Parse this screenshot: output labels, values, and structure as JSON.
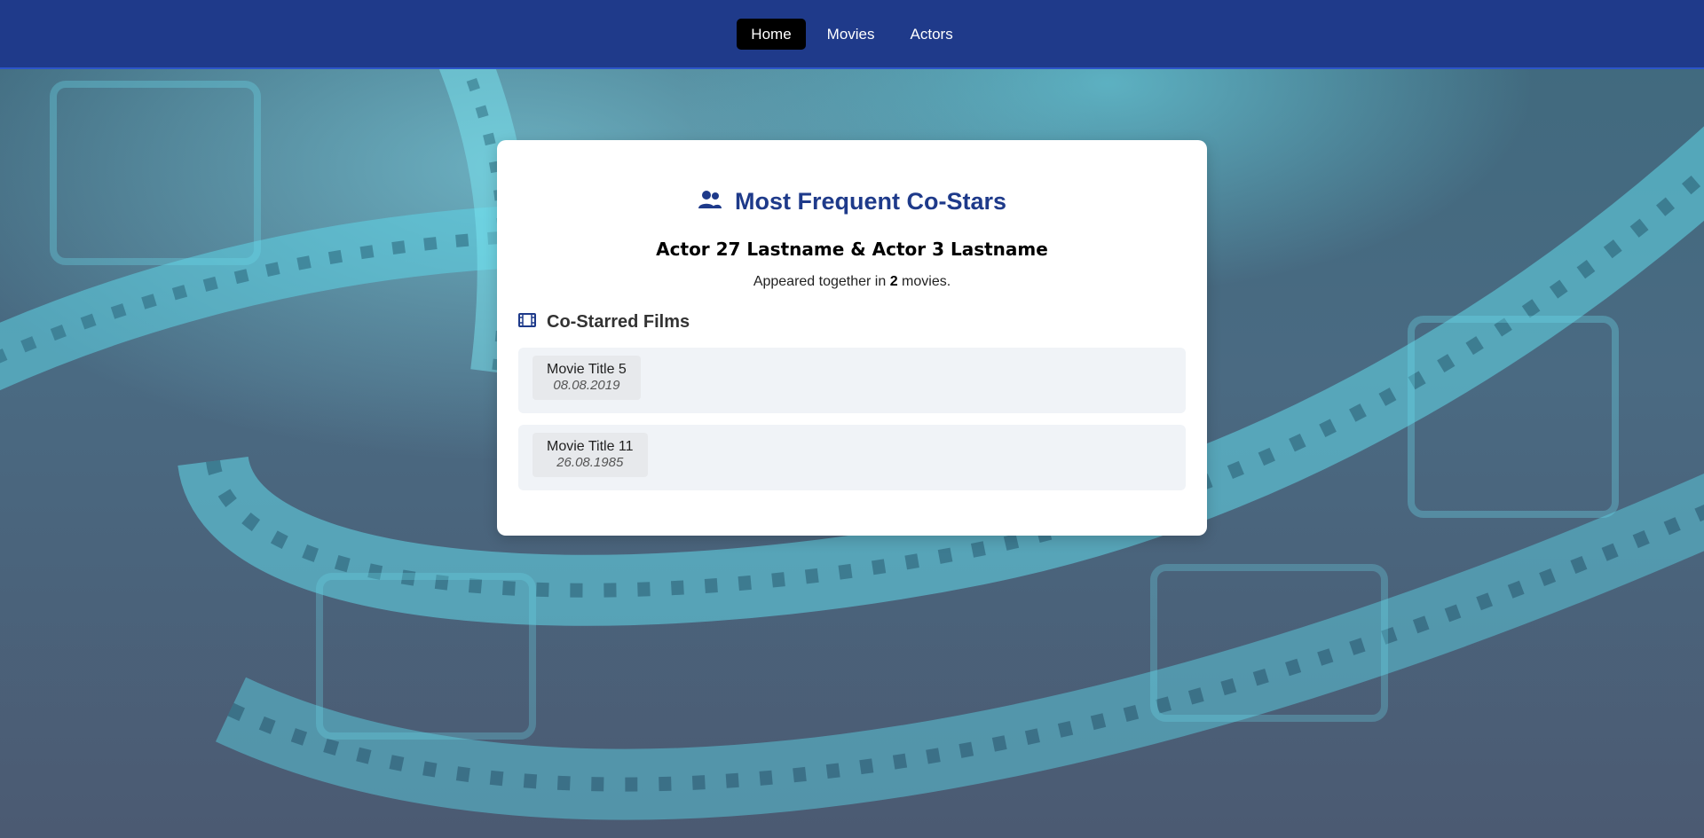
{
  "nav": {
    "items": [
      {
        "label": "Home",
        "active": true
      },
      {
        "label": "Movies",
        "active": false
      },
      {
        "label": "Actors",
        "active": false
      }
    ]
  },
  "card": {
    "title": "Most Frequent Co-Stars",
    "title_icon": "users-icon",
    "actor_pair": "Actor 27 Lastname & Actor 3 Lastname",
    "together_prefix": "Appeared together in ",
    "together_count": "2",
    "together_suffix": " movies.",
    "section_title": "Co-Starred Films",
    "section_icon": "film-icon",
    "films": [
      {
        "title": "Movie Title 5",
        "date": "08.08.2019"
      },
      {
        "title": "Movie Title 11",
        "date": "26.08.1985"
      }
    ]
  },
  "colors": {
    "navbar": "#1f3a8a",
    "accent": "#1e3a8a",
    "active_nav": "#000000"
  }
}
